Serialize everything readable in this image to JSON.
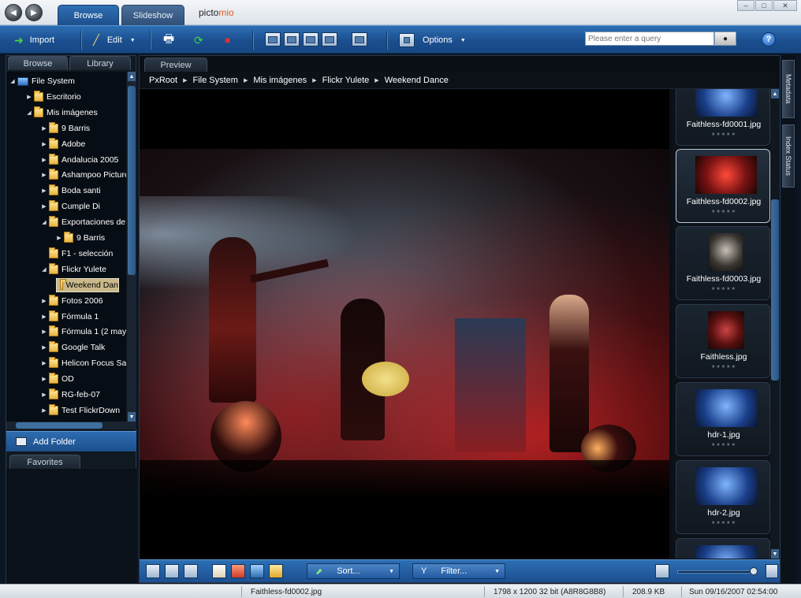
{
  "nav": {
    "back_icon": "back-icon",
    "forward_icon": "forward-icon"
  },
  "tabs": [
    {
      "label": "Browse",
      "active": true
    },
    {
      "label": "Slideshow",
      "active": false
    }
  ],
  "brand": {
    "part1": "picto",
    "part2": "mio"
  },
  "window_controls": {
    "minimize": "–",
    "maximize": "□",
    "close": "✕"
  },
  "toolbar": {
    "import_label": "Import",
    "edit_label": "Edit",
    "options_label": "Options",
    "search_placeholder": "Please enter a query",
    "help_label": "?"
  },
  "left_panel": {
    "tabs": [
      "Browse",
      "Library"
    ],
    "tree": [
      {
        "label": "File System",
        "level": 0,
        "icon": "computer-icon",
        "expanded": true
      },
      {
        "label": "Escritorio",
        "level": 1,
        "expanded": false
      },
      {
        "label": "Mis imágenes",
        "level": 1,
        "expanded": true
      },
      {
        "label": "9 Barris",
        "level": 2,
        "expanded": false
      },
      {
        "label": "Adobe",
        "level": 2,
        "expanded": false
      },
      {
        "label": "Andalucia 2005",
        "level": 2,
        "expanded": false
      },
      {
        "label": "Ashampoo Picture",
        "level": 2,
        "expanded": false
      },
      {
        "label": "Boda santi",
        "level": 2,
        "expanded": false
      },
      {
        "label": "Cumple Di",
        "level": 2,
        "expanded": false
      },
      {
        "label": "Exportaciones de",
        "level": 2,
        "expanded": true
      },
      {
        "label": "9 Barris",
        "level": 3,
        "expanded": false
      },
      {
        "label": "F1 - selección",
        "level": 2,
        "expanded": null
      },
      {
        "label": "Flickr Yulete",
        "level": 2,
        "expanded": true
      },
      {
        "label": "Weekend Dan",
        "level": 3,
        "expanded": null,
        "selected": true
      },
      {
        "label": "Fotos 2006",
        "level": 2,
        "expanded": false
      },
      {
        "label": "Fórmula 1",
        "level": 2,
        "expanded": false
      },
      {
        "label": "Fórmula 1 (2 may",
        "level": 2,
        "expanded": false
      },
      {
        "label": "Google Talk",
        "level": 2,
        "expanded": false
      },
      {
        "label": "Helicon Focus Sa",
        "level": 2,
        "expanded": false
      },
      {
        "label": "OD",
        "level": 2,
        "expanded": false
      },
      {
        "label": "RG-feb-07",
        "level": 2,
        "expanded": false
      },
      {
        "label": "Test FlickrDown",
        "level": 2,
        "expanded": false
      }
    ],
    "add_folder_label": "Add Folder",
    "favorites_label": "Favorites"
  },
  "preview": {
    "tab_label": "Preview",
    "breadcrumb": [
      "PxRoot",
      "File System",
      "Mis imágenes",
      "Flickr Yulete",
      "Weekend Dance"
    ]
  },
  "filmstrip": [
    {
      "name": "Faithless-fd0001.jpg",
      "selected": false,
      "style": "blue"
    },
    {
      "name": "Faithless-fd0002.jpg",
      "selected": true,
      "style": "red"
    },
    {
      "name": "Faithless-fd0003.jpg",
      "selected": false,
      "style": "dark"
    },
    {
      "name": "Faithless.jpg",
      "selected": false,
      "style": "portrait"
    },
    {
      "name": "hdr-1.jpg",
      "selected": false,
      "style": "blue"
    },
    {
      "name": "hdr-2.jpg",
      "selected": false,
      "style": "blue"
    }
  ],
  "bottom_bar": {
    "sort_label": "Sort...",
    "filter_label": "Filter..."
  },
  "right_strip": {
    "metadata_label": "Metadata",
    "index_status_label": "Index Status"
  },
  "statusbar": {
    "filename": "Faithless-fd0002.jpg",
    "dimensions": "1798 x 1200 32 bit (A8R8G8B8)",
    "filesize": "208.9 KB",
    "date": "Sun 09/16/2007 02:54:00"
  },
  "colors": {
    "accent": "#1b4f8f",
    "tab_active": "#2f6fb3",
    "selection": "#c9b98a"
  }
}
